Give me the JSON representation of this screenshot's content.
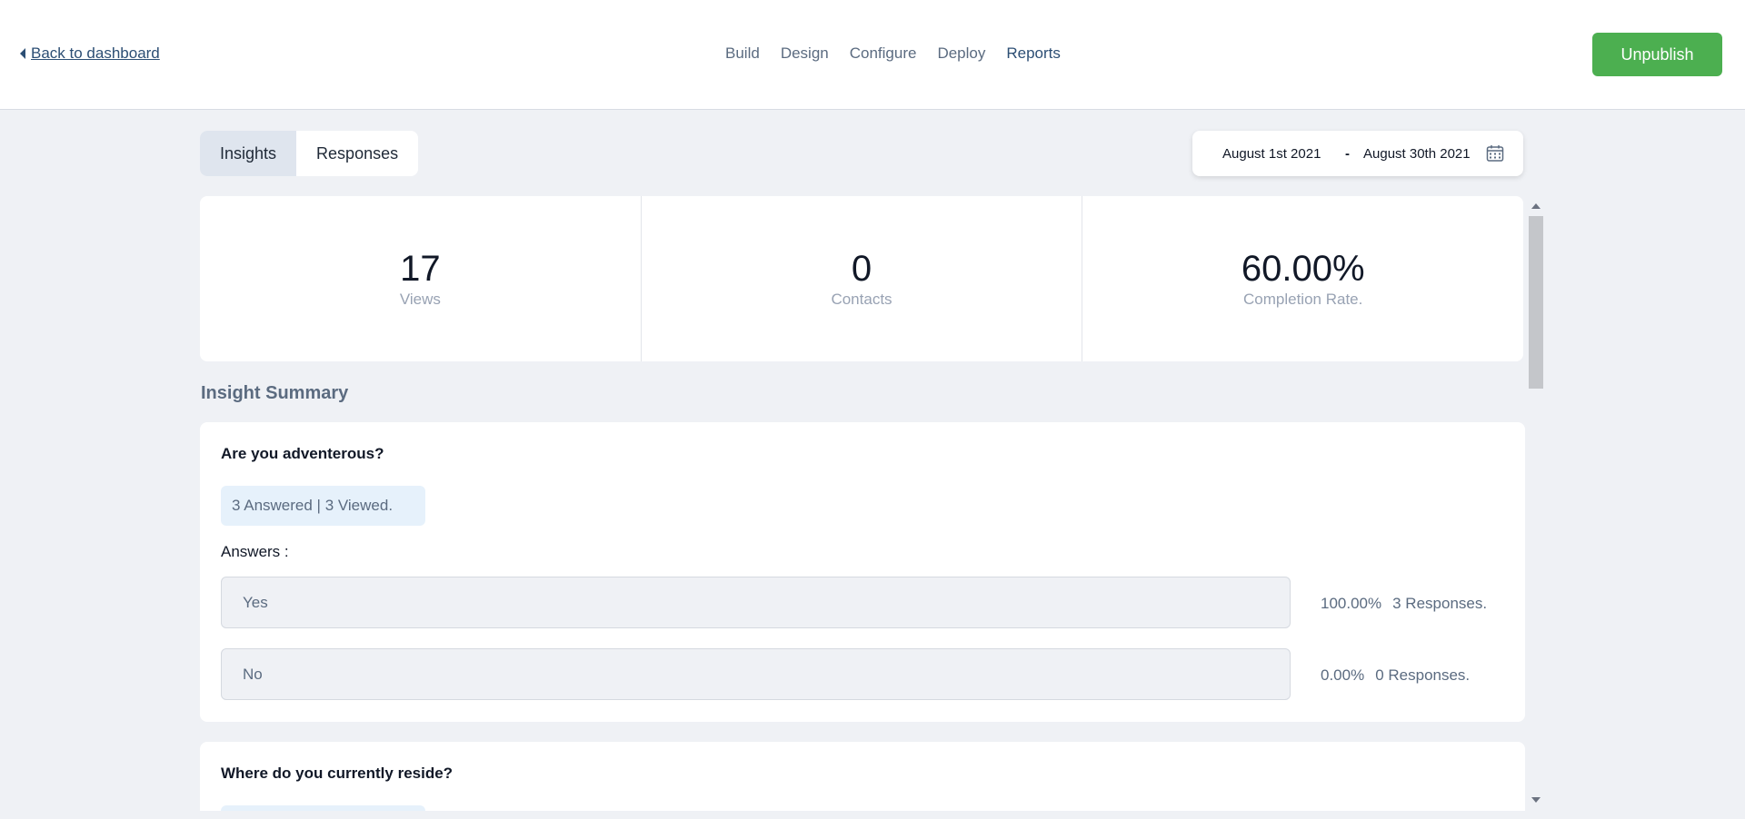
{
  "header": {
    "back_label": "Back to dashboard",
    "nav": [
      "Build",
      "Design",
      "Configure",
      "Deploy",
      "Reports"
    ],
    "active_nav": "Reports",
    "unpublish_label": "Unpublish"
  },
  "tabs": {
    "insights": "Insights",
    "responses": "Responses",
    "active": "Insights"
  },
  "date_range": {
    "start": "August 1st 2021",
    "separator": "-",
    "end": "August 30th 2021"
  },
  "stats": [
    {
      "value": "17",
      "label": "Views"
    },
    {
      "value": "0",
      "label": "Contacts"
    },
    {
      "value": "60.00%",
      "label": "Completion Rate."
    }
  ],
  "summary": {
    "title": "Insight Summary",
    "questions": [
      {
        "title": "Are you adventerous?",
        "badge": "3 Answered | 3 Viewed.",
        "answers_label": "Answers :",
        "answers": [
          {
            "label": "Yes",
            "percent": "100.00%",
            "responses": "3 Responses."
          },
          {
            "label": "No",
            "percent": "0.00%",
            "responses": "0 Responses."
          }
        ]
      },
      {
        "title": "Where do you currently reside?"
      }
    ]
  },
  "colors": {
    "accent": "#4caf50",
    "link": "#2c4e74",
    "muted": "#5b6b80",
    "background": "#eff1f5"
  },
  "icons": {
    "back": "caret-left-icon",
    "calendar": "calendar-icon"
  }
}
